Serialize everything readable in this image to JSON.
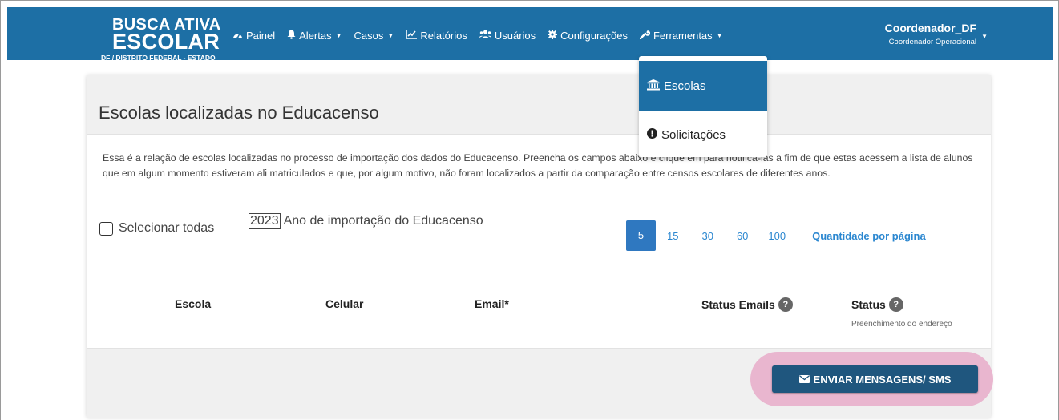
{
  "brand": {
    "line1": "BUSCA ATIVA",
    "line2": "ESCOLAR",
    "line3": "DF / DISTRITO FEDERAL - ESTADO"
  },
  "nav": {
    "items": [
      {
        "label": "Painel",
        "icon": "dashboard-icon",
        "has_caret": false
      },
      {
        "label": "Alertas",
        "icon": "bell-icon",
        "has_caret": true
      },
      {
        "label": "Casos",
        "icon": "",
        "has_caret": true
      },
      {
        "label": "Relatórios",
        "icon": "line-chart-icon",
        "has_caret": false
      },
      {
        "label": "Usuários",
        "icon": "users-icon",
        "has_caret": false
      },
      {
        "label": "Configurações",
        "icon": "gear-icon",
        "has_caret": false
      },
      {
        "label": "Ferramentas",
        "icon": "wrench-icon",
        "has_caret": true
      }
    ]
  },
  "user": {
    "name": "Coordenador_DF",
    "role": "Coordenador Operacional"
  },
  "dropdown": {
    "items": [
      {
        "label": "Escolas",
        "icon": "institution-icon",
        "active": true
      },
      {
        "label": "Solicitações",
        "icon": "exclamation-circle-icon",
        "active": false
      }
    ]
  },
  "page": {
    "title": "Escolas localizadas no Educacenso",
    "description": "Essa é a relação de escolas localizadas no processo de importação dos dados do Educacenso. Preencha os campos abaixo e clique em para notificá-las a fim de que estas acessem a lista de alunos que em algum momento estiveram ali matriculados e que, por algum motivo, não foram localizados a partir da comparação entre censos escolares de diferentes anos.",
    "select_all_label": "Selecionar todas",
    "year_value": "2023",
    "year_label": "Ano de importação do Educacenso",
    "page_sizes": [
      "5",
      "15",
      "30",
      "60",
      "100"
    ],
    "active_page_size": "5",
    "page_size_label": "Quantidade por página"
  },
  "table": {
    "columns": {
      "escola": "Escola",
      "celular": "Celular",
      "email": "Email*",
      "status_emails": "Status Emails",
      "status": "Status",
      "status_sub": "Preenchimento do endereço"
    },
    "help_glyph": "?"
  },
  "footer": {
    "send_label": "ENVIAR MENSAGENS/ SMS"
  },
  "colors": {
    "topbar": "#1d6fa5",
    "primary_button": "#1f567e",
    "highlight": "#e9b6cf",
    "link": "#2b87d0"
  }
}
